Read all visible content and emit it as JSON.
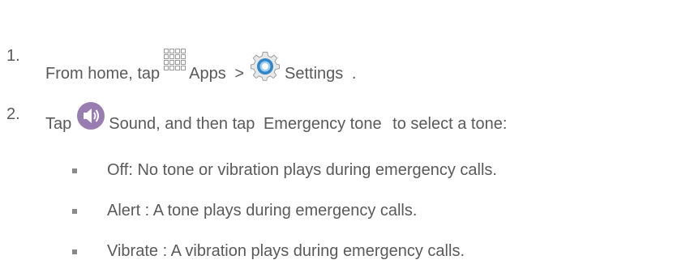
{
  "steps": [
    {
      "number": "1.",
      "text_start": "From home, tap",
      "apps_label": "Apps",
      "separator": ">",
      "settings_label": "Settings",
      "end": "."
    },
    {
      "number": "2.",
      "text_start": "Tap",
      "sound_label": "Sound, and then tap",
      "option_label": "Emergency tone",
      "text_end": "to select a tone:"
    }
  ],
  "bullets": [
    {
      "term": "Off",
      "sep": ":",
      "desc": "No tone or vibration plays during emergency calls."
    },
    {
      "term": "Alert",
      "sep": " :",
      "desc": "A tone plays during emergency calls."
    },
    {
      "term": "Vibrate",
      "sep": " :",
      "desc": "A vibration plays during emergency calls."
    }
  ],
  "icons": {
    "apps": "apps-grid-icon",
    "settings": "settings-gear-icon",
    "sound": "sound-speaker-icon"
  },
  "colors": {
    "text": "#5a5a5a",
    "sound_icon_bg": "#9a7db0",
    "settings_icon_blue": "#2f86c9"
  }
}
